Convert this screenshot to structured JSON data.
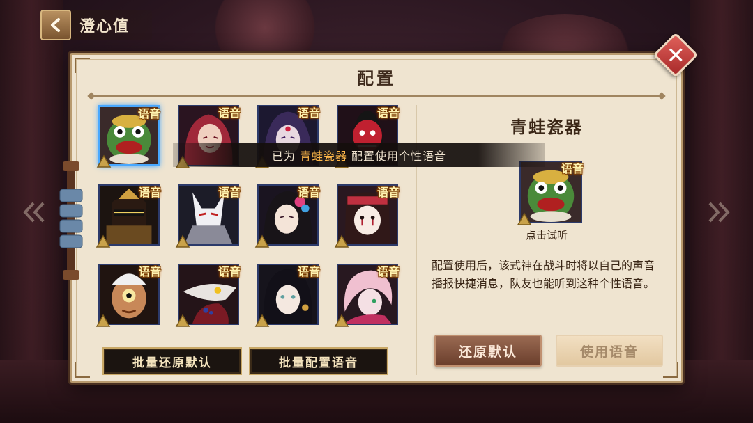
{
  "header": {
    "title": "澄心值"
  },
  "dialog": {
    "title": "配置",
    "close_label": "✕"
  },
  "grid": {
    "badge_label": "语音",
    "cards": [
      {
        "id": "c1",
        "selected": true,
        "theme": "frog"
      },
      {
        "id": "c2",
        "selected": false,
        "theme": "red-hair"
      },
      {
        "id": "c3",
        "selected": false,
        "theme": "purple-hair"
      },
      {
        "id": "c4",
        "selected": false,
        "theme": "red-mask"
      },
      {
        "id": "c5",
        "selected": false,
        "theme": "samurai"
      },
      {
        "id": "c6",
        "selected": false,
        "theme": "fox-mask"
      },
      {
        "id": "c7",
        "selected": false,
        "theme": "black-hair-flower"
      },
      {
        "id": "c8",
        "selected": false,
        "theme": "doll"
      },
      {
        "id": "c9",
        "selected": false,
        "theme": "one-eye"
      },
      {
        "id": "c10",
        "selected": false,
        "theme": "crow-mask"
      },
      {
        "id": "c11",
        "selected": false,
        "theme": "black-hair-girl"
      },
      {
        "id": "c12",
        "selected": false,
        "theme": "pink-hair"
      }
    ]
  },
  "buttons": {
    "batch_reset": "批量还原默认",
    "batch_config": "批量配置语音",
    "restore_default": "还原默认",
    "use_voice": "使用语音"
  },
  "detail": {
    "name": "青蛙瓷器",
    "badge_label": "语音",
    "listen_hint": "点击试听",
    "description": "配置使用后，该式神在战斗时将以自己的声音播报快捷消息，队友也能听到这种个性语音。"
  },
  "toast": {
    "prefix": "已为",
    "highlight": "青蛙瓷器",
    "suffix": "配置使用个性语音"
  },
  "colors": {
    "selected_border": "#48a8ff",
    "toast_highlight": "#ffb84a",
    "restore_button": "#7a4a38",
    "use_button": "#ecd6b4"
  }
}
